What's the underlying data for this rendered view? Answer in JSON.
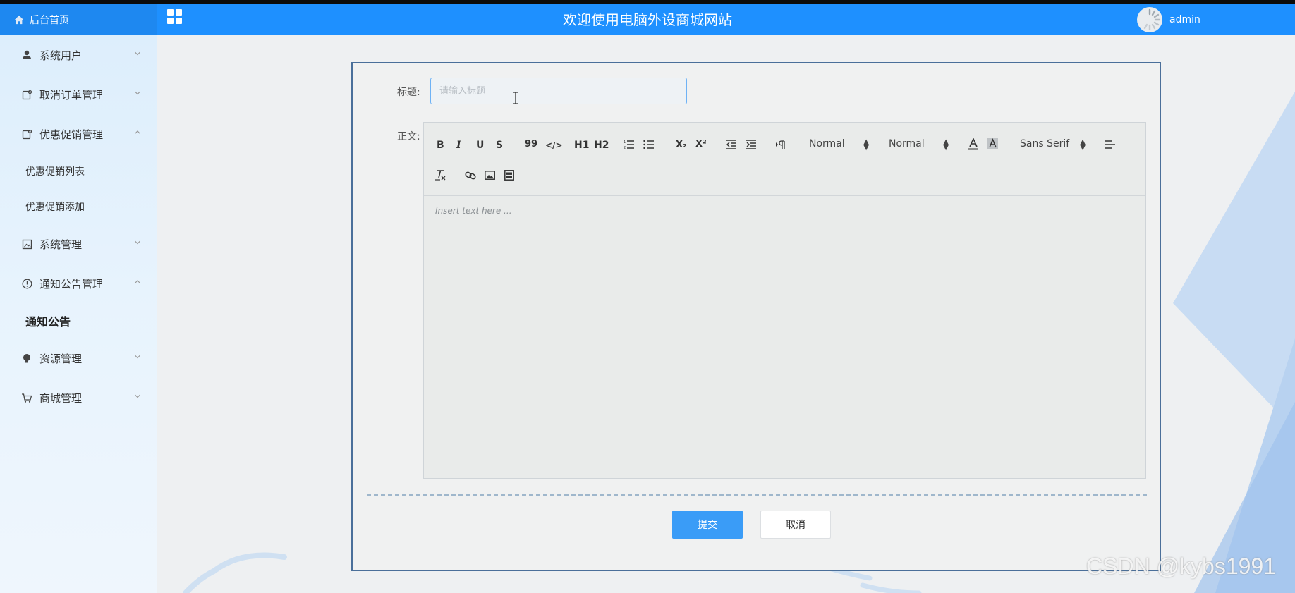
{
  "header": {
    "brand_label": "后台首页",
    "title": "欢迎使用电脑外设商城网站",
    "username": "admin"
  },
  "sidebar": {
    "items": [
      {
        "label": "系统用户",
        "icon": "user-icon",
        "expanded": false
      },
      {
        "label": "取消订单管理",
        "icon": "tag-icon",
        "expanded": false
      },
      {
        "label": "优惠促销管理",
        "icon": "tag-icon",
        "expanded": true,
        "children": [
          {
            "label": "优惠促销列表"
          },
          {
            "label": "优惠促销添加"
          }
        ]
      },
      {
        "label": "系统管理",
        "icon": "image-icon",
        "expanded": false
      },
      {
        "label": "通知公告管理",
        "icon": "info-circle-icon",
        "expanded": true,
        "children": [
          {
            "label": "通知公告",
            "active": true
          }
        ]
      },
      {
        "label": "资源管理",
        "icon": "bulb-icon",
        "expanded": false
      },
      {
        "label": "商城管理",
        "icon": "cart-icon",
        "expanded": false
      }
    ]
  },
  "form": {
    "title_label": "标题:",
    "title_placeholder": "请输入标题",
    "title_value": "",
    "body_label": "正文:",
    "editor_placeholder": "Insert text here ...",
    "toolbar": {
      "bold": "B",
      "italic": "I",
      "underline": "U",
      "strike": "S",
      "blockquote": "99",
      "code": "</>",
      "h1": "H1",
      "h2": "H2",
      "sub": "X₂",
      "sup": "X²",
      "size_picker": "Normal",
      "header_picker": "Normal",
      "font_picker": "Sans Serif"
    },
    "submit_label": "提交",
    "cancel_label": "取消"
  },
  "watermark": "CSDN @kybs1991",
  "colors": {
    "header": "#1e90ff",
    "primary_button": "#3a9cf7",
    "panel_border": "#4a6f9a"
  }
}
